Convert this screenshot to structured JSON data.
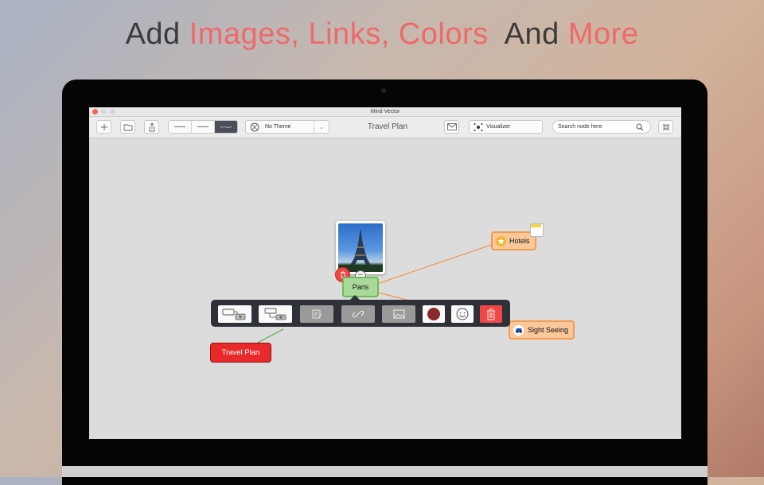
{
  "headline": {
    "part1": "Add ",
    "part2": "Images, Links, Colors",
    "part3": "  And ",
    "part4": "More"
  },
  "window": {
    "title": "Mind Vector"
  },
  "toolbar": {
    "new_icon": "plus-icon",
    "open_icon": "folder-icon",
    "share_icon": "share-icon",
    "line_styles": [
      "straight-line-icon",
      "thin-line-icon",
      "curved-line-icon"
    ],
    "theme_label": "No Theme",
    "document_title": "Travel Plan",
    "email_icon": "envelope-icon",
    "visualizer_label": "Visualizer",
    "search_placeholder": "Search node here",
    "collapse_icon": "collapse-icon"
  },
  "mindmap": {
    "center_node": "Paris",
    "image_node": "eiffel-tower-photo",
    "children": [
      {
        "label": "Hotels",
        "icon": "star-icon",
        "color": "#fbc89b",
        "has_note": true
      },
      {
        "label": "Sight Seeing",
        "icon": "car-icon",
        "color": "#fbc89b"
      }
    ],
    "root_node": {
      "label": "Travel Plan",
      "color": "#ea2a2a"
    }
  },
  "context_toolbar": {
    "items": [
      "add-child-node-icon",
      "add-sibling-node-icon",
      "note-icon",
      "link-icon",
      "image-icon",
      "color-icon",
      "emoji-icon",
      "trash-icon"
    ],
    "selected_color": "#8b2a2a",
    "delete_color": "#f04646"
  },
  "colors": {
    "accent": "#ee6a6a",
    "edge_orange": "#f08a3c",
    "edge_green": "#4ca83c"
  }
}
